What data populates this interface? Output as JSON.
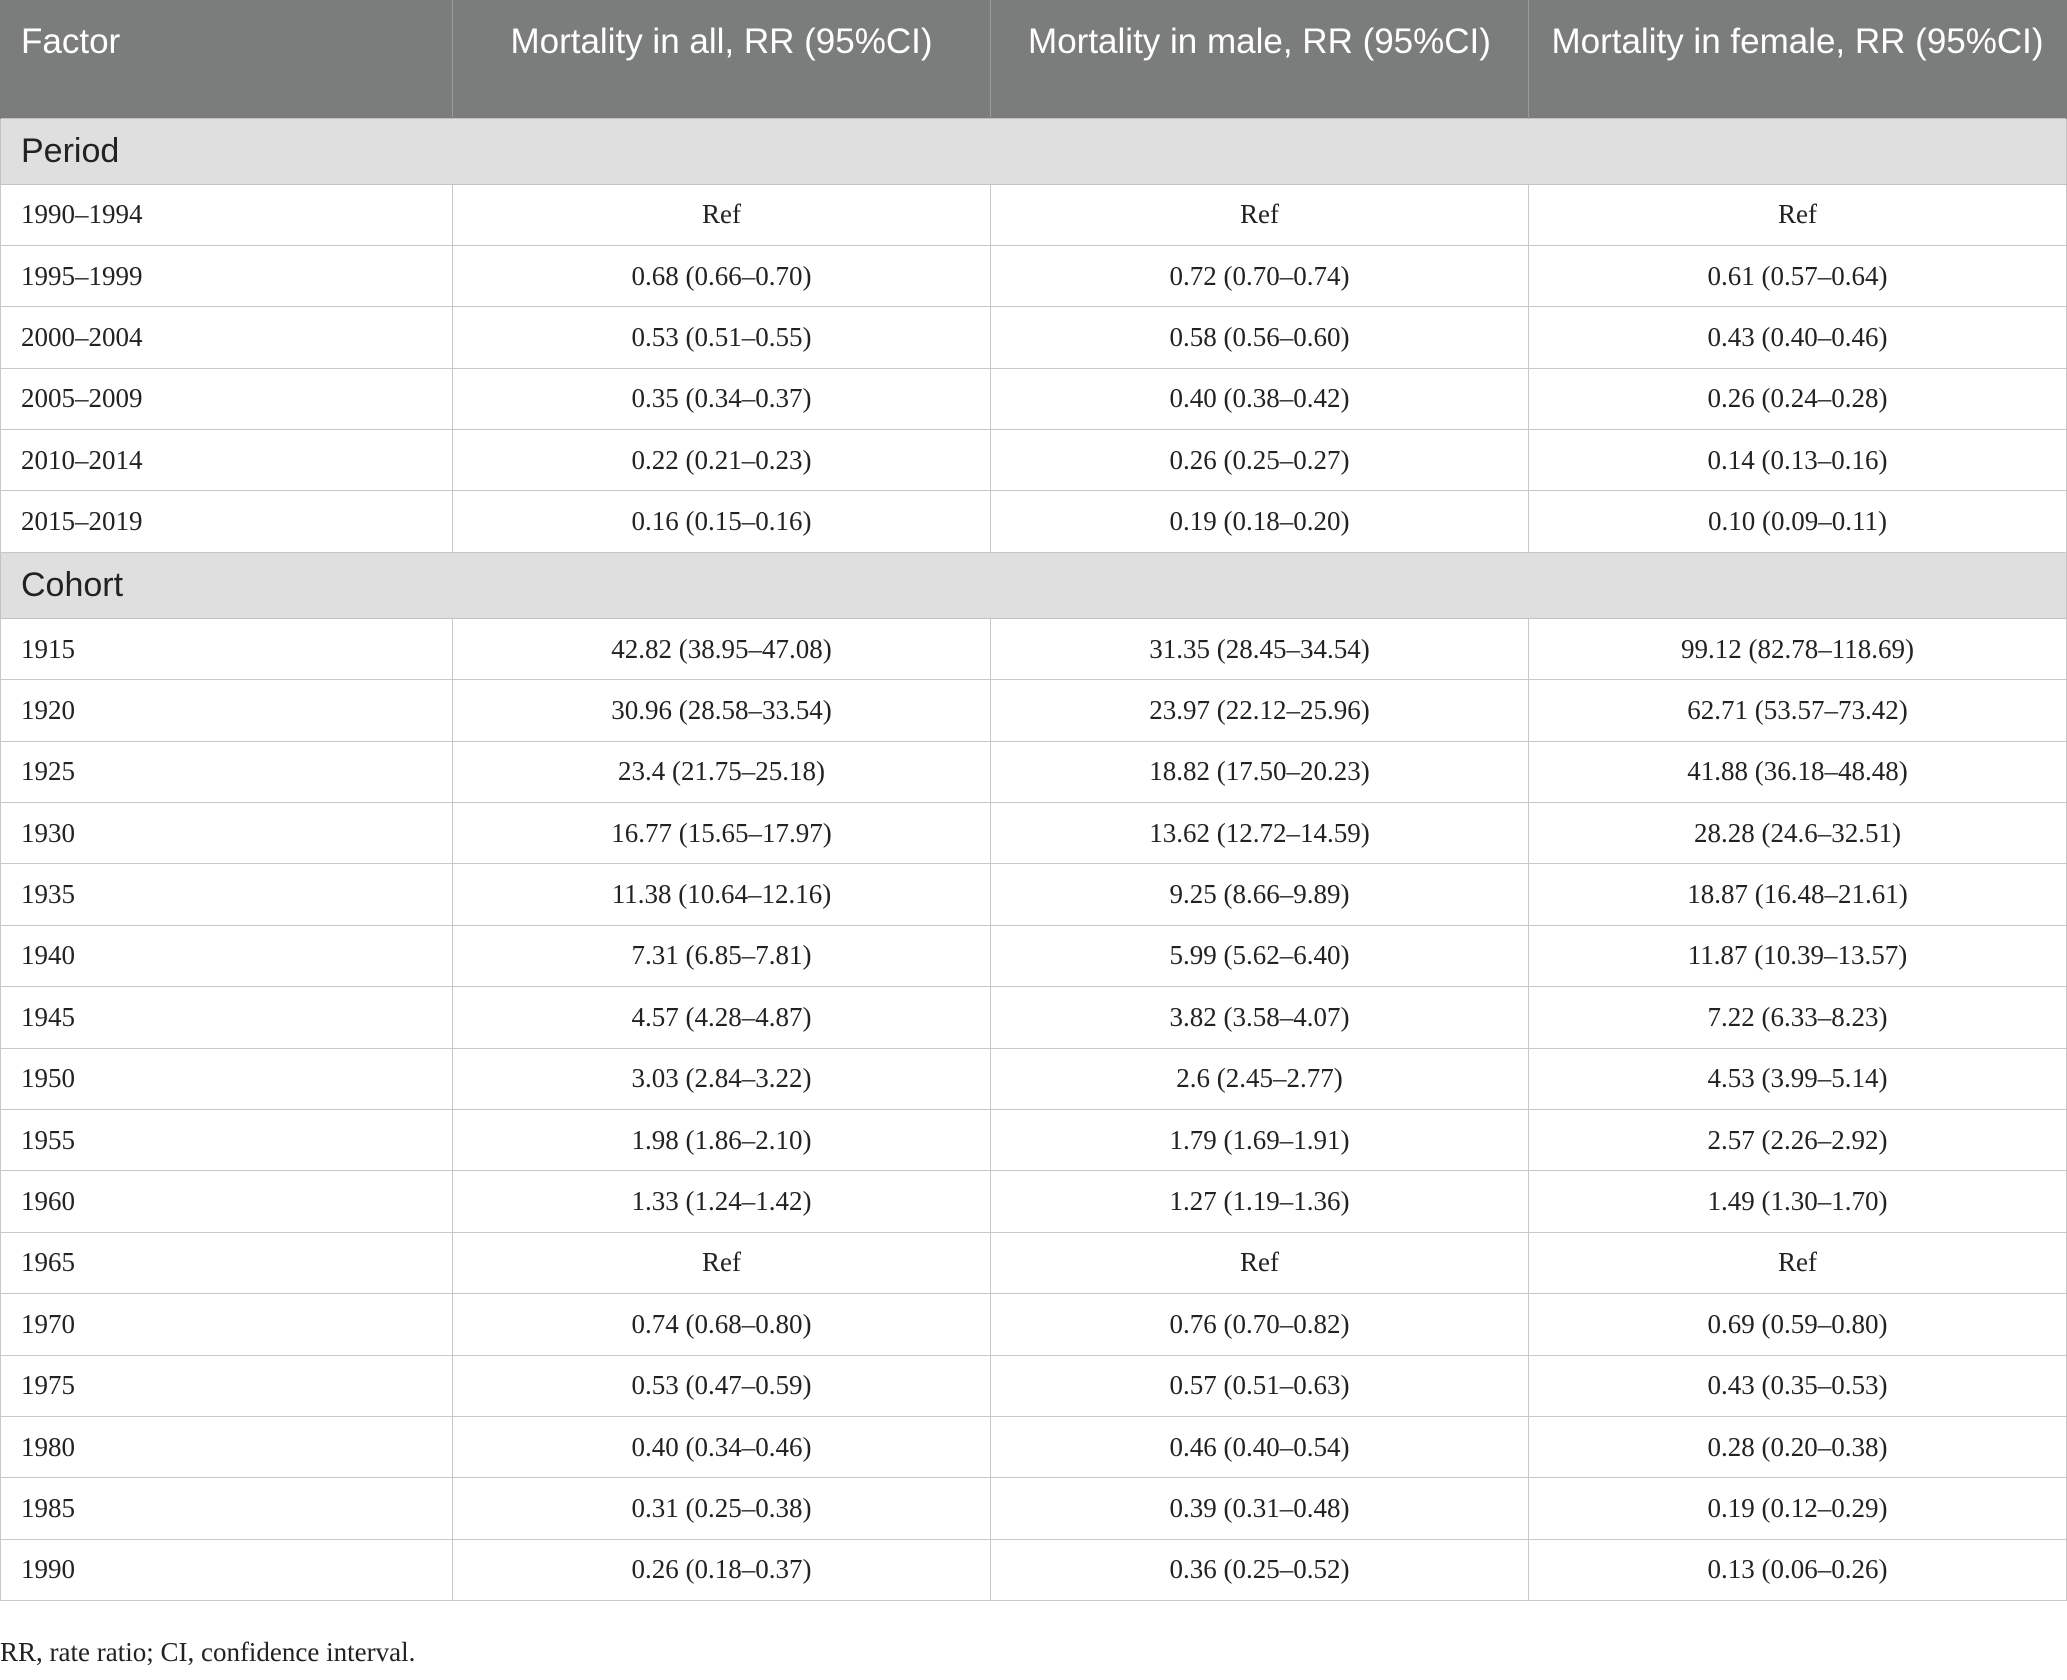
{
  "table": {
    "headers": [
      "Factor",
      "Mortality in all, RR (95%CI)",
      "Mortality in male, RR (95%CI)",
      "Mortality in female, RR (95%CI)"
    ],
    "sections": [
      {
        "title": "Period",
        "rows": [
          [
            "1990–1994",
            "Ref",
            "Ref",
            "Ref"
          ],
          [
            "1995–1999",
            "0.68 (0.66–0.70)",
            "0.72 (0.70–0.74)",
            "0.61 (0.57–0.64)"
          ],
          [
            "2000–2004",
            "0.53 (0.51–0.55)",
            "0.58 (0.56–0.60)",
            "0.43 (0.40–0.46)"
          ],
          [
            "2005–2009",
            "0.35 (0.34–0.37)",
            "0.40 (0.38–0.42)",
            "0.26 (0.24–0.28)"
          ],
          [
            "2010–2014",
            "0.22 (0.21–0.23)",
            "0.26 (0.25–0.27)",
            "0.14 (0.13–0.16)"
          ],
          [
            "2015–2019",
            "0.16 (0.15–0.16)",
            "0.19 (0.18–0.20)",
            "0.10 (0.09–0.11)"
          ]
        ]
      },
      {
        "title": "Cohort",
        "rows": [
          [
            "1915",
            "42.82 (38.95–47.08)",
            "31.35 (28.45–34.54)",
            "99.12 (82.78–118.69)"
          ],
          [
            "1920",
            "30.96 (28.58–33.54)",
            "23.97 (22.12–25.96)",
            "62.71 (53.57–73.42)"
          ],
          [
            "1925",
            "23.4 (21.75–25.18)",
            "18.82 (17.50–20.23)",
            "41.88 (36.18–48.48)"
          ],
          [
            "1930",
            "16.77 (15.65–17.97)",
            "13.62 (12.72–14.59)",
            "28.28 (24.6–32.51)"
          ],
          [
            "1935",
            "11.38 (10.64–12.16)",
            "9.25 (8.66–9.89)",
            "18.87 (16.48–21.61)"
          ],
          [
            "1940",
            "7.31 (6.85–7.81)",
            "5.99 (5.62–6.40)",
            "11.87 (10.39–13.57)"
          ],
          [
            "1945",
            "4.57 (4.28–4.87)",
            "3.82 (3.58–4.07)",
            "7.22 (6.33–8.23)"
          ],
          [
            "1950",
            "3.03 (2.84–3.22)",
            "2.6 (2.45–2.77)",
            "4.53 (3.99–5.14)"
          ],
          [
            "1955",
            "1.98 (1.86–2.10)",
            "1.79 (1.69–1.91)",
            "2.57 (2.26–2.92)"
          ],
          [
            "1960",
            "1.33 (1.24–1.42)",
            "1.27 (1.19–1.36)",
            "1.49 (1.30–1.70)"
          ],
          [
            "1965",
            "Ref",
            "Ref",
            "Ref"
          ],
          [
            "1970",
            "0.74 (0.68–0.80)",
            "0.76 (0.70–0.82)",
            "0.69 (0.59–0.80)"
          ],
          [
            "1975",
            "0.53 (0.47–0.59)",
            "0.57 (0.51–0.63)",
            "0.43 (0.35–0.53)"
          ],
          [
            "1980",
            "0.40 (0.34–0.46)",
            "0.46 (0.40–0.54)",
            "0.28 (0.20–0.38)"
          ],
          [
            "1985",
            "0.31 (0.25–0.38)",
            "0.39 (0.31–0.48)",
            "0.19 (0.12–0.29)"
          ],
          [
            "1990",
            "0.26 (0.18–0.37)",
            "0.36 (0.25–0.52)",
            "0.13 (0.06–0.26)"
          ]
        ]
      }
    ]
  },
  "footnote": "RR, rate ratio; CI, confidence interval."
}
